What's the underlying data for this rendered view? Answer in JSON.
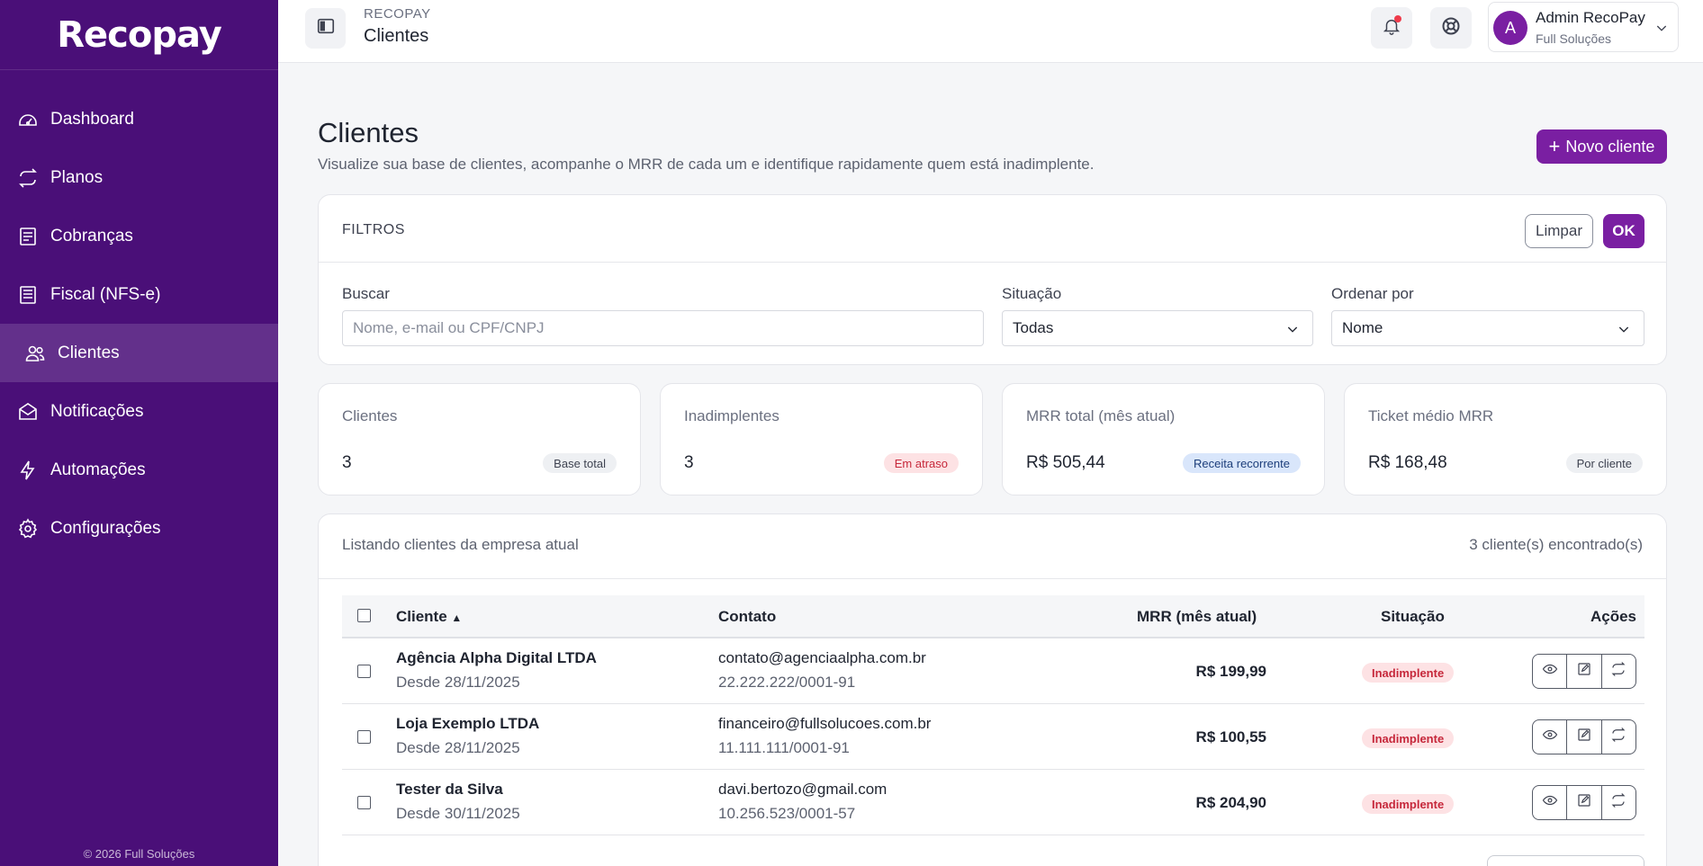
{
  "sidebar": {
    "logo": "Recopay",
    "items": [
      {
        "label": "Dashboard",
        "icon": "gauge-icon"
      },
      {
        "label": "Planos",
        "icon": "repeat-icon"
      },
      {
        "label": "Cobranças",
        "icon": "receipt-icon"
      },
      {
        "label": "Fiscal (NFS-e)",
        "icon": "invoice-icon"
      },
      {
        "label": "Clientes",
        "icon": "users-icon",
        "active": true
      },
      {
        "label": "Notificações",
        "icon": "mail-icon"
      },
      {
        "label": "Automações",
        "icon": "bolt-icon"
      },
      {
        "label": "Configurações",
        "icon": "gear-icon"
      }
    ],
    "footer": "© 2026 Full Soluções"
  },
  "topbar": {
    "app": "RECOPAY",
    "page": "Clientes",
    "user_initial": "A",
    "user_name": "Admin RecoPay",
    "user_org": "Full Soluções"
  },
  "page": {
    "title": "Clientes",
    "subtitle": "Visualize sua base de clientes, acompanhe o MRR de cada um e identifique rapidamente quem está inadimplente.",
    "new_button": "Novo cliente"
  },
  "filters": {
    "title": "FILTROS",
    "clear_label": "Limpar",
    "ok_label": "OK",
    "search_label": "Buscar",
    "search_placeholder": "Nome, e-mail ou CPF/CNPJ",
    "status_label": "Situação",
    "status_value": "Todas",
    "order_label": "Ordenar por",
    "order_value": "Nome"
  },
  "stats": [
    {
      "label": "Clientes",
      "value": "3",
      "badge": "Base total"
    },
    {
      "label": "Inadimplentes",
      "value": "3",
      "badge": "Em atraso"
    },
    {
      "label": "MRR total (mês atual)",
      "value": "R$ 505,44",
      "badge": "Receita recorrente"
    },
    {
      "label": "Ticket médio MRR",
      "value": "R$ 168,48",
      "badge": "Por cliente"
    }
  ],
  "list": {
    "caption": "Listando clientes da empresa atual",
    "count": "3 cliente(s) encontrado(s)",
    "columns": {
      "client": "Cliente",
      "contact": "Contato",
      "mrr": "MRR (mês atual)",
      "status": "Situação",
      "actions": "Ações"
    },
    "rows": [
      {
        "name": "Agência Alpha Digital LTDA",
        "since": "Desde 28/11/2025",
        "email": "contato@agenciaalpha.com.br",
        "doc": "22.222.222/0001-91",
        "mrr": "R$ 199,99",
        "status": "Inadimplente"
      },
      {
        "name": "Loja Exemplo LTDA",
        "since": "Desde 28/11/2025",
        "email": "financeiro@fullsolucoes.com.br",
        "doc": "11.111.111/0001-91",
        "mrr": "R$ 100,55",
        "status": "Inadimplente"
      },
      {
        "name": "Tester da Silva",
        "since": "Desde 30/11/2025",
        "email": "davi.bertozo@gmail.com",
        "doc": "10.256.523/0001-57",
        "mrr": "R$ 204,90",
        "status": "Inadimplente"
      }
    ]
  },
  "colors": {
    "sidebar": "#4a0f78",
    "accent": "#7a1fa2",
    "danger": "#c6283b"
  }
}
